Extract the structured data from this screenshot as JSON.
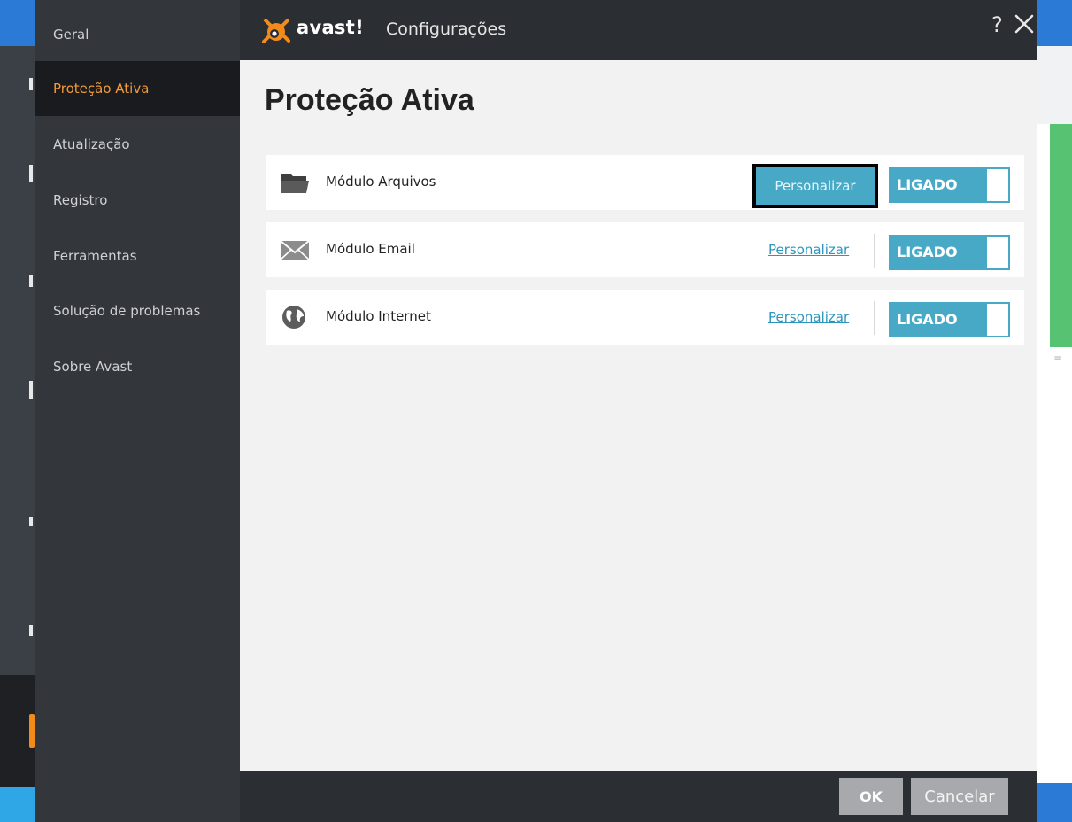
{
  "window": {
    "brand": "avast!",
    "title": "Configurações",
    "help": "?",
    "close_icon": "close-icon"
  },
  "sidebar": {
    "items": [
      {
        "label": "Geral",
        "active": false
      },
      {
        "label": "Proteção Ativa",
        "active": true
      },
      {
        "label": "Atualização",
        "active": false
      },
      {
        "label": "Registro",
        "active": false
      },
      {
        "label": "Ferramentas",
        "active": false
      },
      {
        "label": "Solução de problemas",
        "active": false
      },
      {
        "label": "Sobre Avast",
        "active": false
      }
    ]
  },
  "main": {
    "title": "Proteção Ativa",
    "modules": [
      {
        "label": "Módulo Arquivos",
        "icon": "folder-icon",
        "customize": "Personalizar",
        "customize_style": "button-highlighted",
        "toggle": "LIGADO"
      },
      {
        "label": "Módulo Email",
        "icon": "envelope-icon",
        "customize": "Personalizar",
        "customize_style": "link",
        "toggle": "LIGADO"
      },
      {
        "label": "Módulo Internet",
        "icon": "globe-icon",
        "customize": "Personalizar",
        "customize_style": "link",
        "toggle": "LIGADO"
      }
    ]
  },
  "footer": {
    "ok": "OK",
    "cancel": "Cancelar"
  },
  "colors": {
    "accent": "#48a9c7",
    "active_nav": "#f39a3b",
    "brand_orange": "#f28b1a",
    "sidebar_bg": "#33363b",
    "content_bg": "#f2f2f2"
  }
}
